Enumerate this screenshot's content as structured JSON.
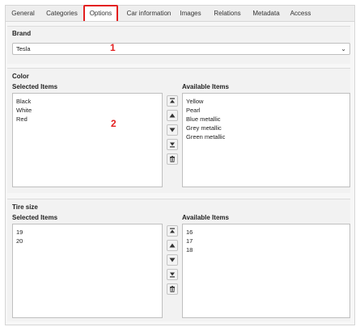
{
  "tabs": [
    {
      "label": "General"
    },
    {
      "label": "Categories"
    },
    {
      "label": "Options"
    },
    {
      "label": "Car information"
    },
    {
      "label": "Images"
    },
    {
      "label": "Relations"
    },
    {
      "label": "Metadata"
    },
    {
      "label": "Access"
    }
  ],
  "brand": {
    "label": "Brand",
    "selected": "Tesla",
    "marker": "1"
  },
  "color": {
    "label": "Color",
    "selected_label": "Selected Items",
    "available_label": "Available Items",
    "selected_items": [
      "Black",
      "White",
      "Red"
    ],
    "available_items": [
      "Yellow",
      "Pearl",
      "Blue metallic",
      "Grey metallic",
      "Green metallic"
    ],
    "marker": "2"
  },
  "tire": {
    "label": "Tire size",
    "selected_label": "Selected Items",
    "available_label": "Available Items",
    "selected_items": [
      "19",
      "20"
    ],
    "available_items": [
      "16",
      "17",
      "18"
    ]
  },
  "accent_color": "#e31f1f"
}
